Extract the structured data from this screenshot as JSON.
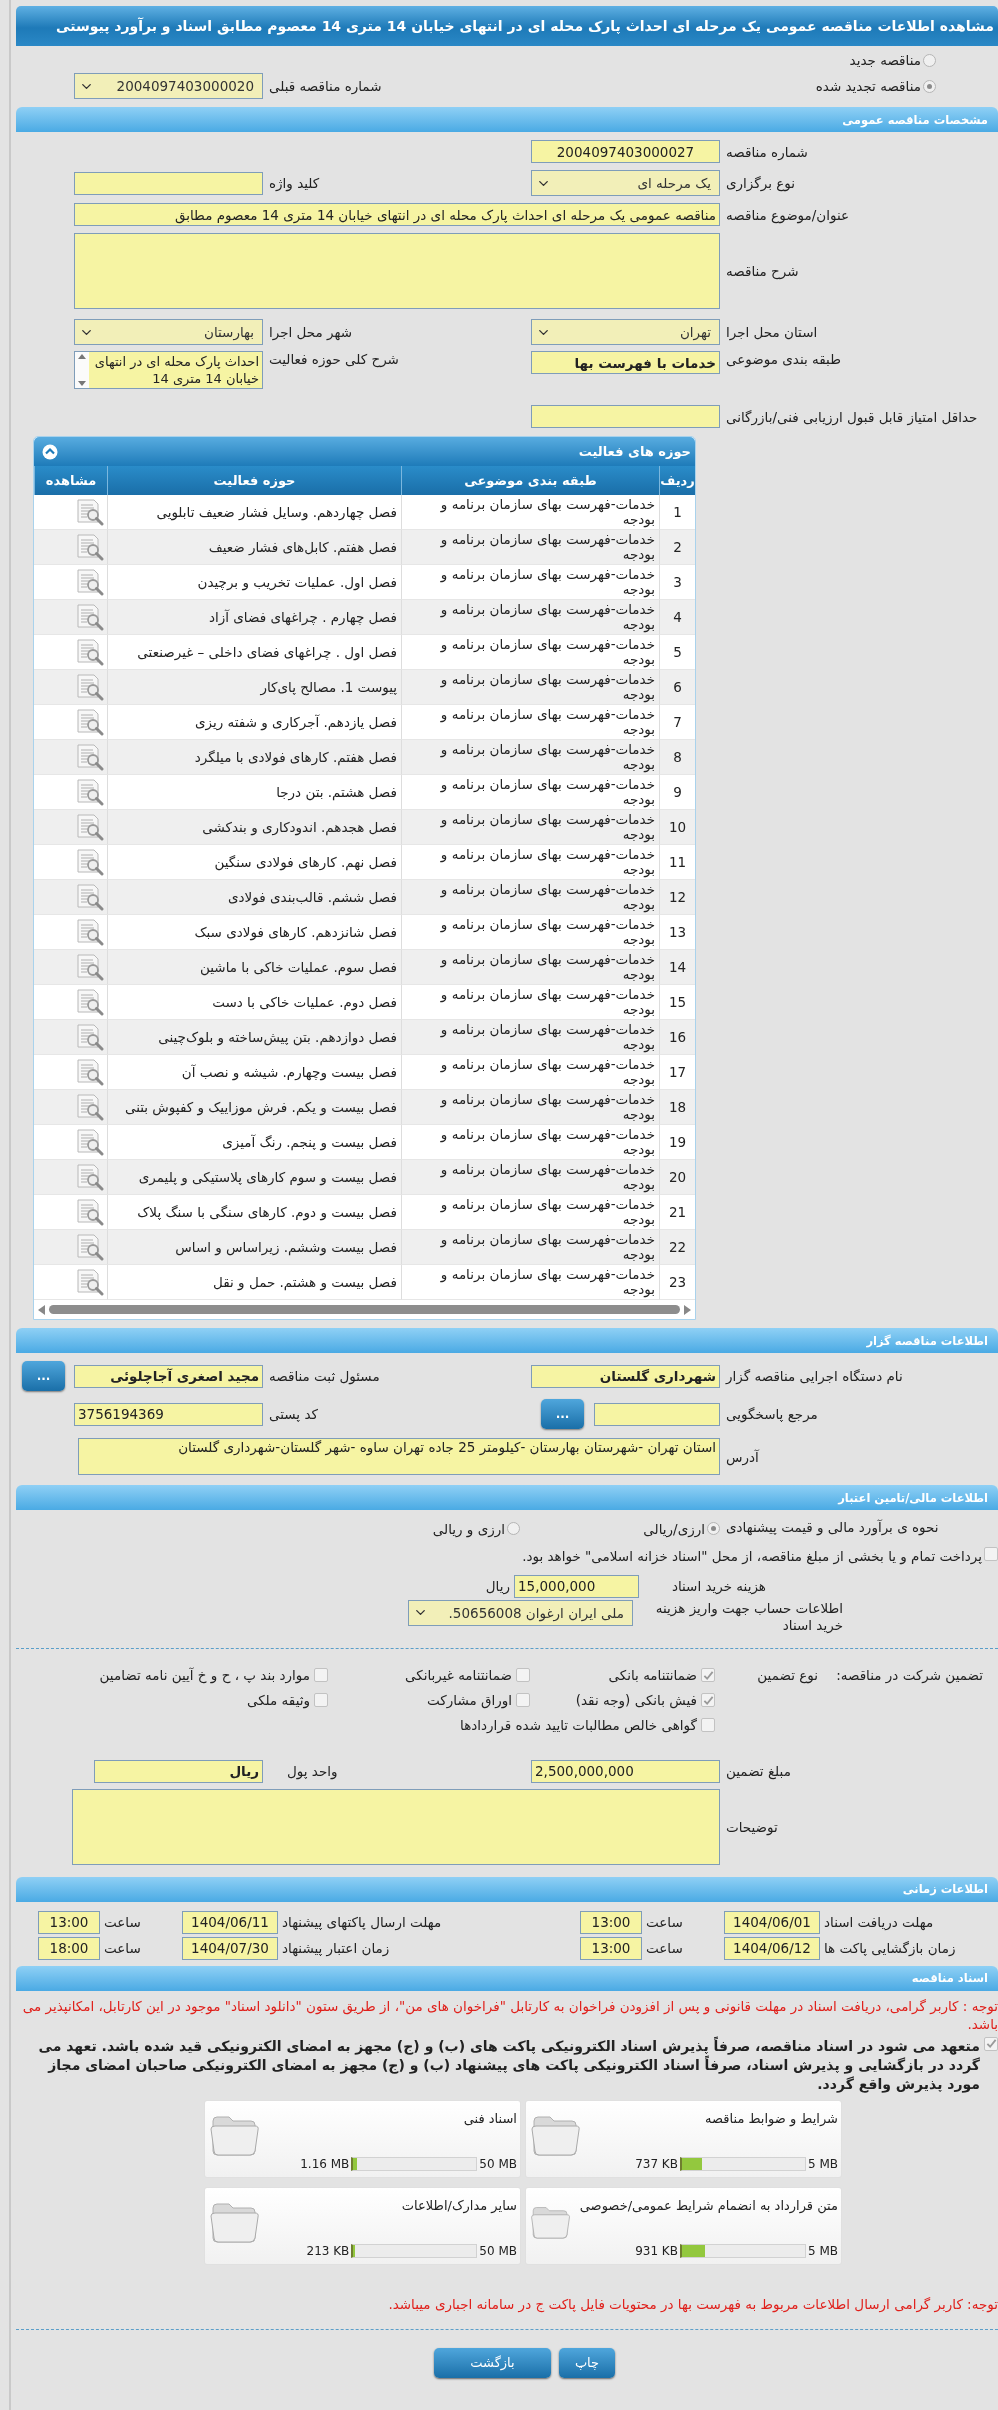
{
  "page_title": "مشاهده اطلاعات مناقصه عمومی یک مرحله ای احداث پارک محله ای در انتهای خیابان 14 متری 14 معصوم مطابق اسناد و برآورد پیوستی",
  "tender_kind": [
    {
      "label": "مناقصه جدید",
      "selected": false
    },
    {
      "label": "مناقصه تجدید شده",
      "selected": true
    }
  ],
  "previous_tender": {
    "label": "شماره مناقصه قبلی",
    "value": "2004097403000020"
  },
  "general": {
    "title": "مشخصات مناقصه عمومی",
    "tender_number": {
      "label": "شماره مناقصه",
      "value": "2004097403000027"
    },
    "holding_type": {
      "label": "نوع برگزاری",
      "value": "یک مرحله ای"
    },
    "keyword": {
      "label": "کلید واژه"
    },
    "subject": {
      "label": "عنوان/موضوع مناقصه",
      "value": "مناقصه عمومی یک مرحله ای احداث پارک محله ای در انتهای خیابان 14 متری 14 معصوم مطابق"
    },
    "description": {
      "label": "شرح مناقصه"
    },
    "province": {
      "label": "استان محل اجرا",
      "value": "تهران"
    },
    "city": {
      "label": "شهر محل اجرا",
      "value": "بهارستان"
    },
    "category": {
      "label": "طبقه بندی موضوعی",
      "value": "خدمات با فهرست بها"
    },
    "activity_summary": {
      "label": "شرح کلی حوزه فعالیت",
      "value": "احداث پارک محله ای در انتهای خیابان 14 متری 14"
    },
    "min_score": {
      "label": "حداقل امتیاز قابل قبول ارزیابی فنی/بازرگانی"
    }
  },
  "activities": {
    "title": "حوزه های فعالیت",
    "expanded": true,
    "columns": [
      "ردیف",
      "طبقه بندی موضوعی",
      "حوزه فعالیت",
      "مشاهده"
    ],
    "rows": [
      {
        "no": "1",
        "category": "خدمات-فهرست بهای سازمان برنامه و بودجه",
        "activity": "فصل چهاردهم. وسایل فشار ضعیف تابلویی"
      },
      {
        "no": "2",
        "category": "خدمات-فهرست بهای سازمان برنامه و بودجه",
        "activity": "فصل هفتم. کابل‌های فشار ضعیف"
      },
      {
        "no": "3",
        "category": "خدمات-فهرست بهای سازمان برنامه و بودجه",
        "activity": "فصل اول. عملیات تخریب و برچیدن"
      },
      {
        "no": "4",
        "category": "خدمات-فهرست بهای سازمان برنامه و بودجه",
        "activity": "فصل چهارم . چراغهای فضای آزاد"
      },
      {
        "no": "5",
        "category": "خدمات-فهرست بهای سازمان برنامه و بودجه",
        "activity": "فصل اول . چراغهای فضای داخلی – غیرصنعتی"
      },
      {
        "no": "6",
        "category": "خدمات-فهرست بهای سازمان برنامه و بودجه",
        "activity": "پیوست 1. مصالح پای‌کار"
      },
      {
        "no": "7",
        "category": "خدمات-فهرست بهای سازمان برنامه و بودجه",
        "activity": "فصل یازدهم. آجرکاری و شفته ریزی"
      },
      {
        "no": "8",
        "category": "خدمات-فهرست بهای سازمان برنامه و بودجه",
        "activity": "فصل هفتم. کارهای فولادی با میلگرد"
      },
      {
        "no": "9",
        "category": "خدمات-فهرست بهای سازمان برنامه و بودجه",
        "activity": "فصل هشتم. بتن درجا"
      },
      {
        "no": "10",
        "category": "خدمات-فهرست بهای سازمان برنامه و بودجه",
        "activity": "فصل هجدهم. اندودکاری و بندکشی"
      },
      {
        "no": "11",
        "category": "خدمات-فهرست بهای سازمان برنامه و بودجه",
        "activity": "فصل نهم. کارهای فولادی سنگین"
      },
      {
        "no": "12",
        "category": "خدمات-فهرست بهای سازمان برنامه و بودجه",
        "activity": "فصل ششم. قالب‌بندی فولادی"
      },
      {
        "no": "13",
        "category": "خدمات-فهرست بهای سازمان برنامه و بودجه",
        "activity": "فصل شانزدهم. کارهای فولادی سبک"
      },
      {
        "no": "14",
        "category": "خدمات-فهرست بهای سازمان برنامه و بودجه",
        "activity": "فصل سوم. عملیات خاکی با ماشین"
      },
      {
        "no": "15",
        "category": "خدمات-فهرست بهای سازمان برنامه و بودجه",
        "activity": "فصل دوم. عملیات خاکی با دست"
      },
      {
        "no": "16",
        "category": "خدمات-فهرست بهای سازمان برنامه و بودجه",
        "activity": "فصل دوازدهم. بتن پیش‌ساخته و بلوک‌چینی"
      },
      {
        "no": "17",
        "category": "خدمات-فهرست بهای سازمان برنامه و بودجه",
        "activity": "فصل بیست وچهارم. شیشه و نصب آن"
      },
      {
        "no": "18",
        "category": "خدمات-فهرست بهای سازمان برنامه و بودجه",
        "activity": "فصل بیست و یکم. فرش موزاییک و کفپوش بتنی"
      },
      {
        "no": "19",
        "category": "خدمات-فهرست بهای سازمان برنامه و بودجه",
        "activity": "فصل بیست و پنجم. رنگ آمیزی"
      },
      {
        "no": "20",
        "category": "خدمات-فهرست بهای سازمان برنامه و بودجه",
        "activity": "فصل بیست و سوم کارهای پلاستیکی و پلیمری"
      },
      {
        "no": "21",
        "category": "خدمات-فهرست بهای سازمان برنامه و بودجه",
        "activity": "فصل بیست و دوم. کارهای سنگی با سنگ پلاک"
      },
      {
        "no": "22",
        "category": "خدمات-فهرست بهای سازمان برنامه و بودجه",
        "activity": "فصل بیست وششم. زیراساس و اساس"
      },
      {
        "no": "23",
        "category": "خدمات-فهرست بهای سازمان برنامه و بودجه",
        "activity": "فصل بیست و هشتم. حمل و نقل"
      }
    ]
  },
  "organizer": {
    "title": "اطلاعات مناقصه گزار",
    "agency": {
      "label": "نام دستگاه اجرایی مناقصه گزار",
      "value": "شهرداری گلستان"
    },
    "registrar": {
      "label": "مسئول ثبت مناقصه",
      "value": "مجید اصغری آجاچلوئی"
    },
    "registrar_button": "...",
    "reference": {
      "label": "مرجع پاسخگویی"
    },
    "reference_button": "...",
    "postal_code": {
      "label": "کد پستی",
      "value": "3756194369"
    },
    "address": {
      "label": "آدرس",
      "value": "استان تهران -شهرستان بهارستان -کیلومتر 25 جاده تهران ساوه -شهر گلستان-شهرداری گلستان"
    }
  },
  "finance": {
    "title": "اطلاعات مالی/تامین اعتبار",
    "estimate": {
      "label": "نحوه ی برآورد مالی و قیمت پیشنهادی",
      "options": [
        {
          "label": "ارزی/ریالی",
          "selected": true
        },
        {
          "label": "ارزی و ریالی",
          "selected": false
        }
      ]
    },
    "treasury": {
      "label": "پرداخت تمام و یا بخشی از مبلغ مناقصه، از محل \"اسناد خزانه اسلامی\" خواهد بود.",
      "checked": false
    },
    "doc_cost": {
      "label": "هزینه خرید اسناد",
      "value": "15,000,000",
      "unit": "ریال"
    },
    "account": {
      "label": "اطلاعات حساب جهت واریز هزینه خرید اسناد",
      "value": "ملی ایران ارغوان 50656008."
    },
    "guarantee": {
      "label": "تضمین شرکت در مناقصه:",
      "type_label": "نوع تضمین",
      "columns": [
        [
          {
            "label": "ضمانتنامه بانکی",
            "checked": true
          },
          {
            "label": "فیش بانکی (وجه نقد)",
            "checked": true
          },
          {
            "label": "گواهی خالص مطالبات تایید شده قراردادها",
            "checked": false
          }
        ],
        [
          {
            "label": "ضمانتنامه غیربانکی",
            "checked": false
          },
          {
            "label": "اوراق مشارکت",
            "checked": false
          }
        ],
        [
          {
            "label": "موارد بند پ ، ح و خ آیین نامه تضامین",
            "checked": false
          },
          {
            "label": "وثیقه ملکی",
            "checked": false
          }
        ]
      ]
    },
    "amount": {
      "label": "مبلغ تضمین",
      "value": "2,500,000,000"
    },
    "currency": {
      "label": "واحد پول",
      "value": "ریال"
    },
    "notes": {
      "label": "توضیحات"
    }
  },
  "timing": {
    "title": "اطلاعات زمانی",
    "items": [
      {
        "label": "مهلت دریافت اسناد",
        "date": "1404/06/01",
        "time_label": "ساعت",
        "time": "13:00"
      },
      {
        "label": "مهلت ارسال پاکتهای پیشنهاد",
        "date": "1404/06/11",
        "time_label": "ساعت",
        "time": "13:00"
      },
      {
        "label": "زمان بازگشایی پاکت ها",
        "date": "1404/06/12",
        "time_label": "ساعت",
        "time": "13:00"
      },
      {
        "label": "زمان اعتبار پیشنهاد",
        "date": "1404/07/30",
        "time_label": "ساعت",
        "time": "18:00"
      }
    ]
  },
  "documents": {
    "title": "اسناد مناقصه",
    "notice": "توجه : کاربر گرامی، دریافت اسناد در مهلت قانونی و پس از افزودن فراخوان به کارتابل \"فراخوان های من\"، از طریق ستون \"دانلود اسناد\" موجود در این کارتابل، امکانپذیر می باشد.",
    "pledge": {
      "text": "متعهد می شود در اسناد مناقصه، صرفاً پذیرش اسناد الکترونیکی پاکت های (ب) و (ج) مجهز به امضای الکترونیکی قید شده باشد. تعهد می گردد در بازگشایی و پذیرش اسناد، صرفاً اسناد الکترونیکی پاکت های پیشنهاد (ب) و (ج) مجهز به امضای الکترونیکی صاحبان امضای مجاز مورد پذیرش واقع گردد.",
      "checked": true
    },
    "files": [
      {
        "title": "شرایط و ضوابط مناقصه",
        "used": "737 KB",
        "limit": "5 MB",
        "level": 0.16
      },
      {
        "title": "اسناد فنی",
        "used": "1.16 MB",
        "limit": "50 MB",
        "level": 0.03
      },
      {
        "title": "متن قرارداد به انضمام شرایط عمومی/خصوصی",
        "used": "931 KB",
        "limit": "5 MB",
        "level": 0.19
      },
      {
        "title": "سایر مدارک/اطلاعات",
        "used": "213 KB",
        "limit": "50 MB",
        "level": 0.01
      }
    ],
    "footer_note": "توجه: کاربر گرامی ارسال اطلاعات مربوط به فهرست بها در محتویات فایل پاکت ج در سامانه اجباری میباشد."
  },
  "buttons": [
    {
      "kind": "print",
      "label": "چاپ"
    },
    {
      "kind": "back",
      "label": "بازگشت"
    }
  ]
}
